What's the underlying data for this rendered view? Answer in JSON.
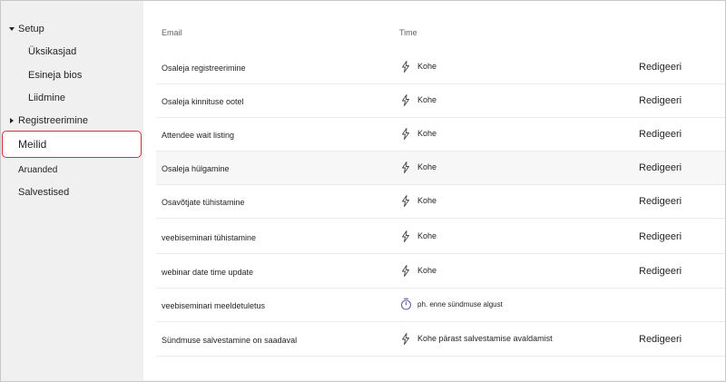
{
  "sidebar": {
    "items": [
      {
        "label": "Setup",
        "expanded": true
      },
      {
        "label": "Üksikasjad"
      },
      {
        "label": "Esineja bios"
      },
      {
        "label": "Liidmine"
      },
      {
        "label": "Registreerimine",
        "expanded": false
      },
      {
        "label": "Meilid",
        "selected": true
      },
      {
        "label": "Aruanded"
      },
      {
        "label": "Salvestised"
      }
    ]
  },
  "table": {
    "headers": {
      "email": "Email",
      "time": "Time"
    },
    "rows": [
      {
        "email": "Osaleja registreerimine",
        "time": "Kohe",
        "icon": "lightning-icon",
        "action": "Redigeeri"
      },
      {
        "email": "Osaleja kinnituse ootel",
        "time": "Kohe",
        "icon": "lightning-icon",
        "action": "Redigeeri"
      },
      {
        "email": "Attendee wait listing",
        "time": "Kohe",
        "icon": "lightning-icon",
        "action": "Redigeeri"
      },
      {
        "email": "Osaleja hülgamine",
        "time": "Kohe",
        "icon": "lightning-icon",
        "action": "Redigeeri"
      },
      {
        "email": "Osavõtjate tühistamine",
        "time": "Kohe",
        "icon": "lightning-icon",
        "action": "Redigeeri"
      },
      {
        "email": "veebiseminari tühistamine",
        "time": "Kohe",
        "icon": "lightning-icon",
        "action": "Redigeeri"
      },
      {
        "email": "webinar date time update",
        "time": "Kohe",
        "icon": "lightning-icon",
        "action": "Redigeeri"
      },
      {
        "email": "veebiseminari meeldetuletus",
        "time": "ph. enne sündmuse algust",
        "icon": "timer-icon",
        "action": ""
      },
      {
        "email": "Sündmuse salvestamine on saadaval",
        "time": "Kohe pärast salvestamise avaldamist",
        "icon": "lightning-icon",
        "action": "Redigeeri"
      }
    ]
  },
  "colors": {
    "selected_border": "#d13438",
    "timer_icon": "#6264a7",
    "sidebar_bg": "#f0f0f0"
  }
}
